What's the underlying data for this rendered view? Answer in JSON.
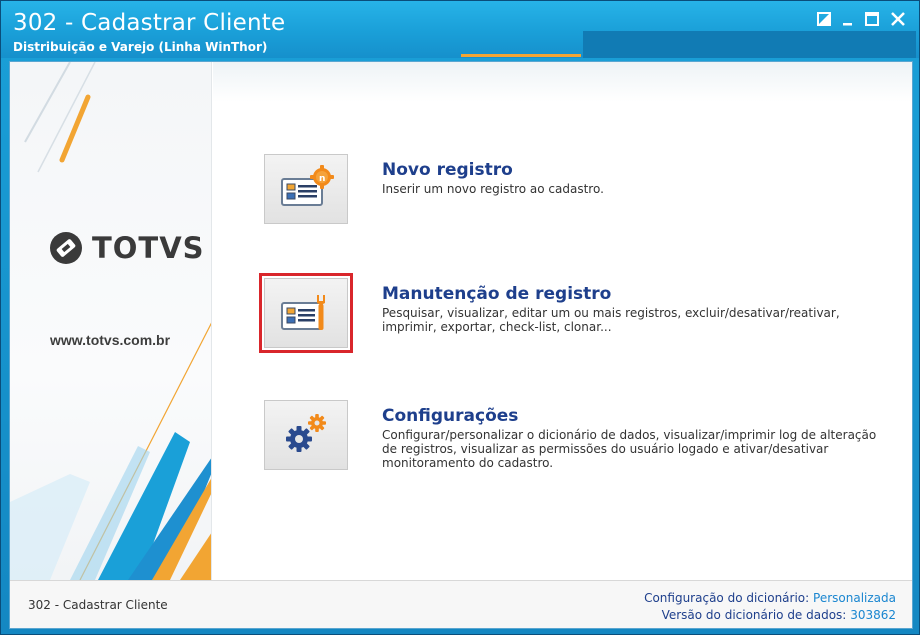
{
  "window": {
    "title": "302 - Cadastrar Cliente",
    "subtitle": "Distribuição e Varejo (Linha WinThor)",
    "controls": [
      "restore-icon",
      "minimize-icon",
      "maximize-icon",
      "close-icon"
    ]
  },
  "sidebar": {
    "logo_text": "TOTVS",
    "website": "www.totvs.com.br"
  },
  "options": [
    {
      "title": "Novo registro",
      "description": "Inserir um novo registro ao cadastro.",
      "icon": "new-record-icon"
    },
    {
      "title": "Manutenção de registro",
      "description": "Pesquisar, visualizar, editar um ou mais registros, excluir/desativar/reativar, imprimir, exportar, check-list,  clonar...",
      "icon": "maintenance-record-icon",
      "selected": true
    },
    {
      "title": "Configurações",
      "description": "Configurar/personalizar o dicionário de dados, visualizar/imprimir log de alteração de registros, visualizar as permissões do usuário logado e ativar/desativar monitoramento do cadastro.",
      "icon": "settings-gears-icon"
    }
  ],
  "status": {
    "left": "302 - Cadastrar Cliente",
    "config_label": "Configuração do dicionário:",
    "config_value": "Personalizada",
    "version_label": "Versão do dicionário de dados:",
    "version_value": "303862"
  },
  "colors": {
    "titlebar": "#1a9fd8",
    "accent_orange": "#f2a533",
    "option_title": "#1e3f8c",
    "selection_border": "#d9262b",
    "status_value": "#1a86d0"
  }
}
